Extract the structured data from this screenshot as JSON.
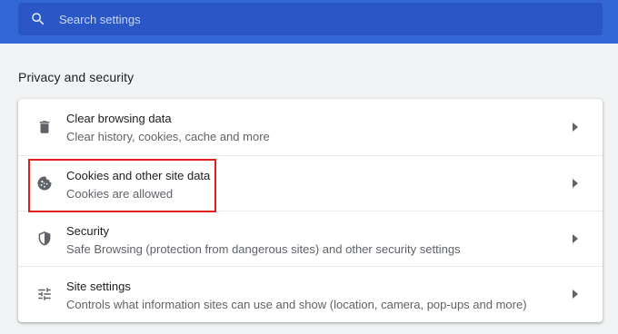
{
  "search": {
    "placeholder": "Search settings"
  },
  "section": {
    "title": "Privacy and security"
  },
  "rows": [
    {
      "title": "Clear browsing data",
      "subtitle": "Clear history, cookies, cache and more",
      "icon": "trash-icon"
    },
    {
      "title": "Cookies and other site data",
      "subtitle": "Cookies are allowed",
      "icon": "cookie-icon"
    },
    {
      "title": "Security",
      "subtitle": "Safe Browsing (protection from dangerous sites) and other security settings",
      "icon": "shield-icon"
    },
    {
      "title": "Site settings",
      "subtitle": "Controls what information sites can use and show (location, camera, pop-ups and more)",
      "icon": "sliders-icon"
    }
  ],
  "colors": {
    "header": "#3367d6",
    "search_bg": "#2a56c6",
    "highlight": "#e0201c"
  }
}
